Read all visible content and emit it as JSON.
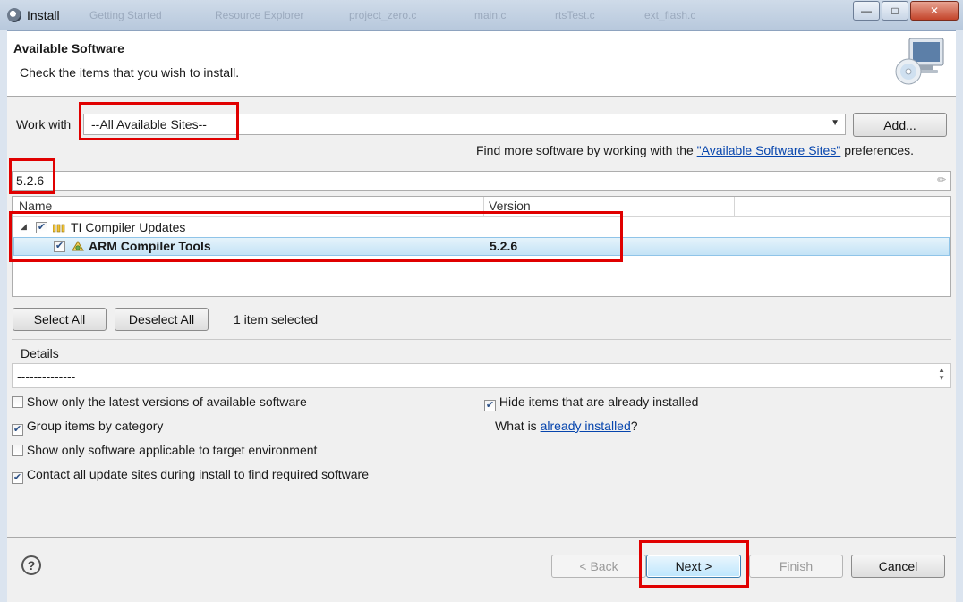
{
  "window": {
    "title": "Install",
    "background_tabs": [
      "Getting Started",
      "Resource Explorer",
      "project_zero.c",
      "main.c",
      "rtsTest.c",
      "ext_flash.c"
    ],
    "controls": {
      "minimize": "—",
      "maximize": "□",
      "close": "✕"
    }
  },
  "header": {
    "title": "Available Software",
    "subtitle": "Check the items that you wish to install.",
    "graphic_icon": "install-cd-monitor-icon"
  },
  "work_with": {
    "label": "Work with",
    "value": "--All Available Sites--",
    "add_button": "Add..."
  },
  "find_more": {
    "prefix": "Find more software by working with the ",
    "link": "\"Available Software Sites\"",
    "suffix": " preferences."
  },
  "filter": {
    "value": "5.2.6"
  },
  "table": {
    "columns": [
      "Name",
      "Version",
      ""
    ],
    "rows": [
      {
        "name": "TI Compiler Updates",
        "version": "",
        "checked": true,
        "expanded": true,
        "icon": "category-icon"
      },
      {
        "name": "ARM Compiler Tools",
        "version": "5.2.6",
        "checked": true,
        "selected": true,
        "icon": "feature-icon"
      }
    ]
  },
  "selection": {
    "select_all": "Select All",
    "deselect_all": "Deselect All",
    "status": "1 item selected"
  },
  "details": {
    "label": "Details",
    "text": "--------------"
  },
  "options": {
    "show_latest": {
      "label": "Show only the latest versions of available software",
      "checked": false
    },
    "group_by_category": {
      "label": "Group items by category",
      "checked": true
    },
    "target_env": {
      "label": "Show only software applicable to target environment",
      "checked": false
    },
    "contact_sites": {
      "label": "Contact all update sites during install to find required software",
      "checked": true
    },
    "hide_installed": {
      "label": "Hide items that are already installed",
      "checked": true
    },
    "what_is_prefix": "What is ",
    "what_is_link": "already installed",
    "what_is_suffix": "?"
  },
  "footer": {
    "help": "?",
    "back": "< Back",
    "next": "Next >",
    "finish": "Finish",
    "cancel": "Cancel"
  },
  "colors": {
    "highlight_box": "#e00000",
    "link": "#0645ad",
    "selected_row": "#c4e3f6"
  }
}
